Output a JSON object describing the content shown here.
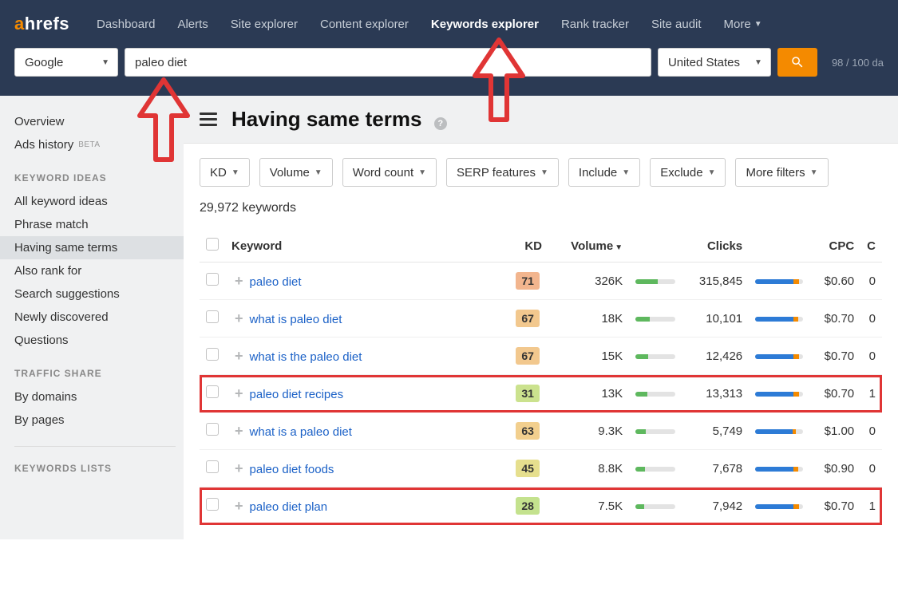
{
  "logo": {
    "a": "a",
    "rest": "hrefs"
  },
  "nav": {
    "items": [
      "Dashboard",
      "Alerts",
      "Site explorer",
      "Content explorer",
      "Keywords explorer",
      "Rank tracker",
      "Site audit",
      "More"
    ],
    "active_index": 4
  },
  "search": {
    "engine": "Google",
    "query": "paleo diet",
    "country": "United States",
    "credits": "98 / 100 da"
  },
  "sidebar": {
    "top": [
      {
        "label": "Overview"
      },
      {
        "label": "Ads history",
        "beta": "BETA"
      }
    ],
    "sections": [
      {
        "title": "KEYWORD IDEAS",
        "items": [
          {
            "label": "All keyword ideas"
          },
          {
            "label": "Phrase match"
          },
          {
            "label": "Having same terms",
            "selected": true
          },
          {
            "label": "Also rank for"
          },
          {
            "label": "Search suggestions"
          },
          {
            "label": "Newly discovered"
          },
          {
            "label": "Questions"
          }
        ]
      },
      {
        "title": "TRAFFIC SHARE",
        "items": [
          {
            "label": "By domains"
          },
          {
            "label": "By pages"
          }
        ]
      },
      {
        "title": "KEYWORDS LISTS",
        "items": []
      }
    ]
  },
  "page": {
    "title": "Having same terms",
    "count_text": "29,972 keywords"
  },
  "filters": [
    "KD",
    "Volume",
    "Word count",
    "SERP features",
    "Include",
    "Exclude",
    "More filters"
  ],
  "columns": {
    "keyword": "Keyword",
    "kd": "KD",
    "volume": "Volume",
    "clicks": "Clicks",
    "cpc": "CPC",
    "extra": "C"
  },
  "rows": [
    {
      "keyword": "paleo diet",
      "kd": 71,
      "kd_bg": "#f2b58e",
      "volume": "326K",
      "vol_pct": 55,
      "clicks": "315,845",
      "cb": 80,
      "co": 12,
      "cpc": "$0.60",
      "extra": "0",
      "highlight": false
    },
    {
      "keyword": "what is paleo diet",
      "kd": 67,
      "kd_bg": "#f2c88e",
      "volume": "18K",
      "vol_pct": 35,
      "clicks": "10,101",
      "cb": 80,
      "co": 10,
      "cpc": "$0.70",
      "extra": "0",
      "highlight": false
    },
    {
      "keyword": "what is the paleo diet",
      "kd": 67,
      "kd_bg": "#f2c88e",
      "volume": "15K",
      "vol_pct": 32,
      "clicks": "12,426",
      "cb": 80,
      "co": 12,
      "cpc": "$0.70",
      "extra": "0",
      "highlight": false
    },
    {
      "keyword": "paleo diet recipes",
      "kd": 31,
      "kd_bg": "#cbe28e",
      "volume": "13K",
      "vol_pct": 30,
      "clicks": "13,313",
      "cb": 80,
      "co": 12,
      "cpc": "$0.70",
      "extra": "1",
      "highlight": true
    },
    {
      "keyword": "what is a paleo diet",
      "kd": 63,
      "kd_bg": "#f2cf8e",
      "volume": "9.3K",
      "vol_pct": 25,
      "clicks": "5,749",
      "cb": 78,
      "co": 6,
      "cpc": "$1.00",
      "extra": "0",
      "highlight": false
    },
    {
      "keyword": "paleo diet foods",
      "kd": 45,
      "kd_bg": "#e6df8e",
      "volume": "8.8K",
      "vol_pct": 24,
      "clicks": "7,678",
      "cb": 80,
      "co": 10,
      "cpc": "$0.90",
      "extra": "0",
      "highlight": false
    },
    {
      "keyword": "paleo diet plan",
      "kd": 28,
      "kd_bg": "#c4e28e",
      "volume": "7.5K",
      "vol_pct": 22,
      "clicks": "7,942",
      "cb": 80,
      "co": 12,
      "cpc": "$0.70",
      "extra": "1",
      "highlight": true
    }
  ]
}
